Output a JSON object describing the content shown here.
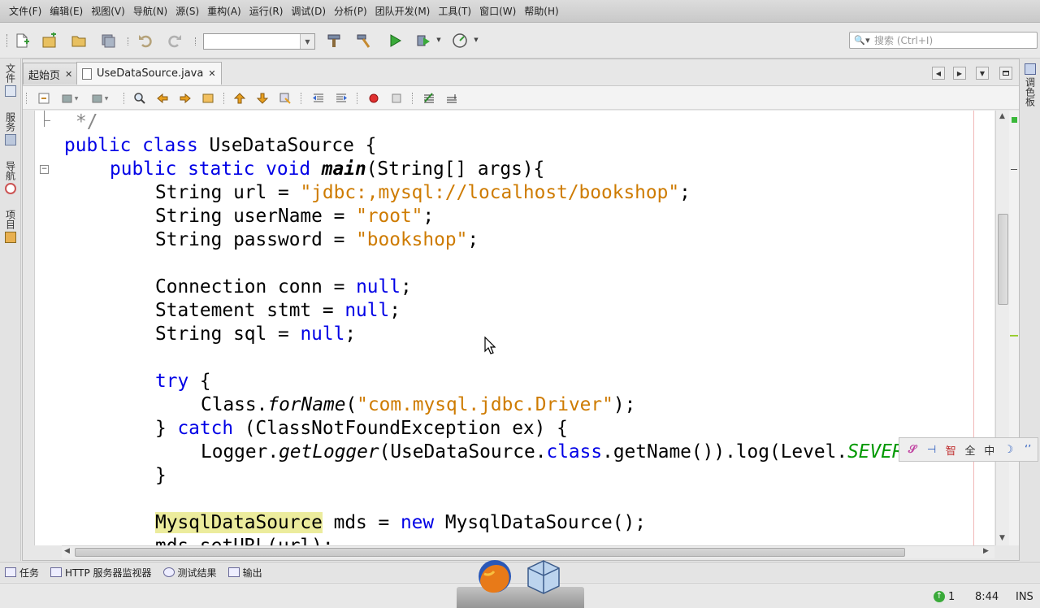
{
  "menubar": {
    "items": [
      "文件(F)",
      "编辑(E)",
      "视图(V)",
      "导航(N)",
      "源(S)",
      "重构(A)",
      "运行(R)",
      "调试(D)",
      "分析(P)",
      "团队开发(M)",
      "工具(T)",
      "窗口(W)",
      "帮助(H)"
    ]
  },
  "toolbar": {
    "search_placeholder": "搜索 (Ctrl+I)"
  },
  "left_strip": {
    "tabs": [
      "文件",
      "服务",
      "导航",
      "项目"
    ]
  },
  "right_strip": {
    "tabs": [
      "调色板"
    ]
  },
  "editor": {
    "tabs": [
      {
        "label": "起始页",
        "active": false
      },
      {
        "label": "UseDataSource.java",
        "active": true
      }
    ]
  },
  "code": {
    "comment_end": "*/",
    "lines": {
      "l1_a": "public class ",
      "l1_b": "UseDataSource {",
      "l2_a": "public static void ",
      "l2_b": "main",
      "l2_c": "(String[] args){",
      "l3_a": "String url = ",
      "l3_b": "\"jdbc:,mysql://localhost/bookshop\"",
      "l3_c": ";",
      "l4_a": "String userName = ",
      "l4_b": "\"root\"",
      "l4_c": ";",
      "l5_a": "String password = ",
      "l5_b": "\"bookshop\"",
      "l5_c": ";",
      "l6_a": "Connection conn = ",
      "l6_b": "null",
      "l6_c": ";",
      "l7_a": "Statement stmt = ",
      "l7_b": "null",
      "l7_c": ";",
      "l8_a": "String sql = ",
      "l8_b": "null",
      "l8_c": ";",
      "l9_a": "try",
      "l9_b": " {",
      "l10_a": "Class.",
      "l10_b": "forName",
      "l10_c": "(",
      "l10_d": "\"com.mysql.jdbc.Driver\"",
      "l10_e": ");",
      "l11_a": "} ",
      "l11_b": "catch",
      "l11_c": " (ClassNotFoundException ex) {",
      "l12_a": "Logger.",
      "l12_b": "getLogger",
      "l12_c": "(UseDataSource.",
      "l12_d": "class",
      "l12_e": ".getName()).log(Level.",
      "l12_f": "SEVERE",
      "l13_a": "}",
      "l14_a": "MysqlDataSource",
      "l14_b": " mds = ",
      "l14_c": "new",
      "l14_d": " MysqlDataSource();",
      "l15_a": "mds.setURL(url);"
    }
  },
  "panel_bar": {
    "tabs": [
      "任务",
      "HTTP 服务器监视器",
      "测试结果",
      "输出"
    ]
  },
  "status_bar": {
    "notifications": "1",
    "position": "8:44",
    "mode": "INS"
  },
  "ime": {
    "items": [
      "𝒮",
      "⊣",
      "智",
      "全",
      "中",
      "☽",
      "‘’"
    ]
  },
  "colors": {
    "keyword": "#0000e6",
    "string": "#ce7b00",
    "constant": "#009900",
    "highlight": "#ecec9d"
  }
}
